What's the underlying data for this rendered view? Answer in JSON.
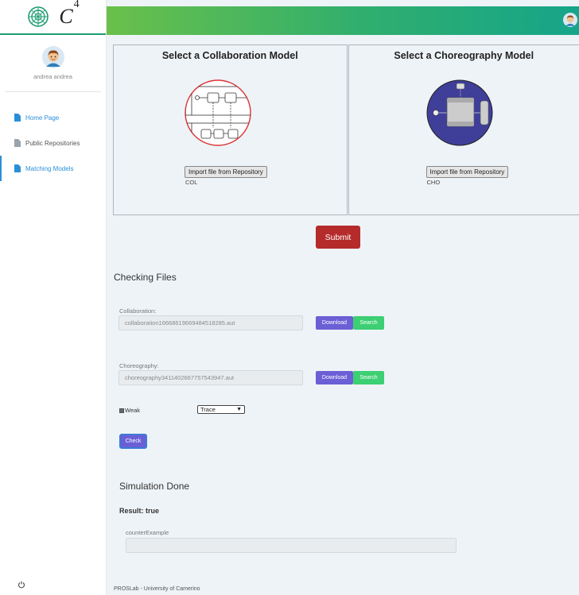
{
  "app": {
    "logo_text": "C",
    "logo_sup": "4"
  },
  "profile": {
    "name": "andrea andrea"
  },
  "nav": [
    {
      "label": "Home Page"
    },
    {
      "label": "Public Repositories"
    },
    {
      "label": "Matching Models"
    }
  ],
  "panels": {
    "collaboration": {
      "title": "Select a Collaboration Model",
      "import_label": "Import file from Repository",
      "file": "COL"
    },
    "choreography": {
      "title": "Select a Choreography Model",
      "import_label": "Import file from Repository",
      "file": "CHO"
    }
  },
  "submit_label": "Submit",
  "checking": {
    "title": "Checking Files",
    "collab_label": "Collaboration:",
    "collab_value": "collaboration16668619669484518285.aut",
    "choreo_label": "Choreography:",
    "choreo_value": "choreography3411402667757543947.aut",
    "download_label": "Download",
    "search_label": "Search",
    "weak_label": "Weak",
    "relation_selected": "Trace",
    "check_label": "Check"
  },
  "simulation": {
    "title": "Simulation Done",
    "result": "Result: true",
    "counter_label": "counterExample",
    "counter_value": ""
  },
  "footer": "PROSLab - University of Camerino",
  "colors": {
    "accent_green": "#1e9c73",
    "submit_red": "#b52a2a",
    "download_purple": "#6b5fd6",
    "search_green": "#3ccf73",
    "nav_blue": "#2b8fd8"
  },
  "icons": [
    "logo-target-icon",
    "avatar-icon",
    "document-icon",
    "power-icon"
  ]
}
